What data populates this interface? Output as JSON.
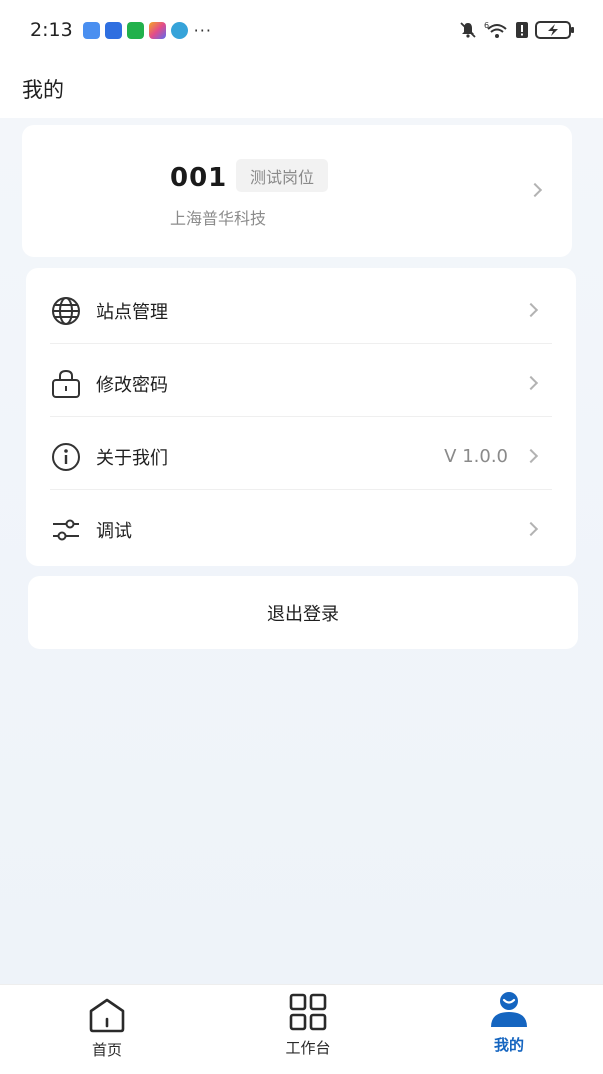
{
  "status_bar": {
    "time": "2:13",
    "more": "···",
    "app_icon_colors": [
      "#4a8ff0",
      "#2f6fe0",
      "#22b14c",
      "#e34b8a",
      "#36a3d9"
    ],
    "signal_label": "6"
  },
  "header": {
    "title": "我的"
  },
  "profile": {
    "name": "001",
    "role": "测试岗位",
    "company": "上海普华科技"
  },
  "menu": {
    "items": [
      {
        "label": "站点管理",
        "icon": "globe-icon"
      },
      {
        "label": "修改密码",
        "icon": "lock-icon"
      },
      {
        "label": "关于我们",
        "icon": "info-icon",
        "value": "V 1.0.0"
      },
      {
        "label": "调试",
        "icon": "sliders-icon"
      }
    ]
  },
  "logout": {
    "label": "退出登录"
  },
  "tabbar": {
    "tabs": [
      {
        "label": "首页",
        "icon": "home-icon"
      },
      {
        "label": "工作台",
        "icon": "grid-icon"
      },
      {
        "label": "我的",
        "icon": "user-icon",
        "active": true
      }
    ],
    "active_color": "#1565c0"
  }
}
